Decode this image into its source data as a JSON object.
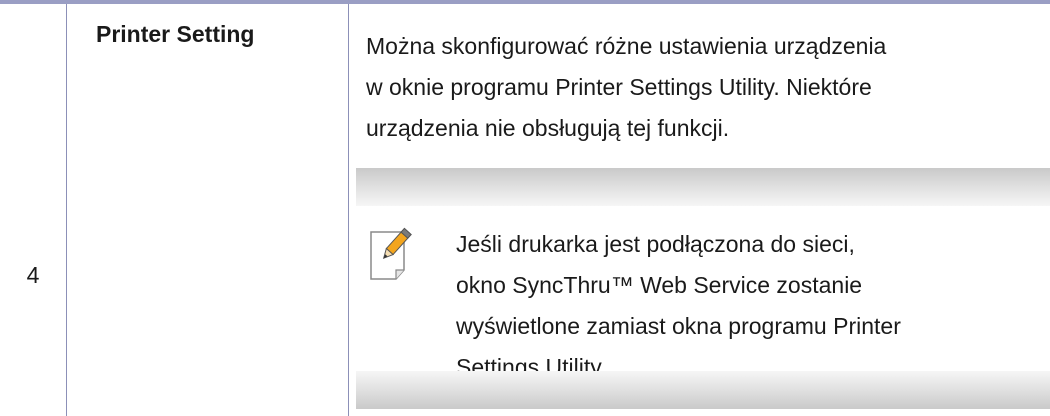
{
  "row": {
    "number": "4",
    "feature": "Printer Setting",
    "description": "Można skonfigurować różne ustawienia urządzenia\nw oknie programu Printer Settings Utility. Niektóre\nurządzenia nie obsługują tej funkcji.",
    "note": {
      "icon": "note-pencil-icon",
      "text": "Jeśli drukarka jest podłączona do sieci,\nokno SyncThru™ Web Service zostanie\nwyświetlone zamiast okna programu Printer\nSettings Utility."
    }
  },
  "colors": {
    "table_border": "#9a9ec4",
    "note_bar": "#d6d6d6",
    "icon_accent": "#f0a21a"
  }
}
